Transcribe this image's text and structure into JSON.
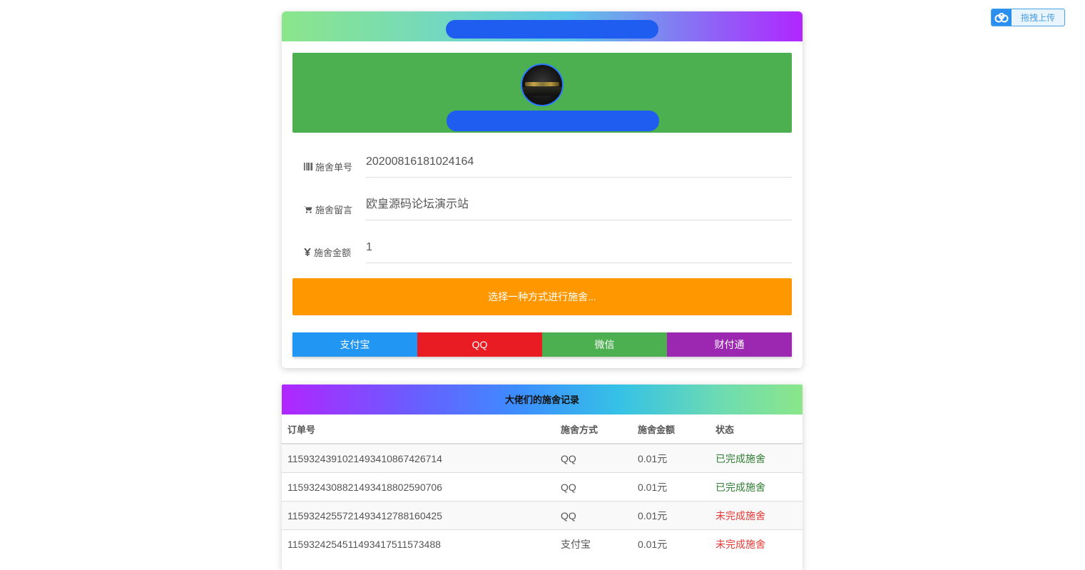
{
  "upload": {
    "label": "拖拽上传",
    "icon": "cloud-icon"
  },
  "form": {
    "order_label": "施舍单号",
    "order_value": "20200816181024164",
    "message_label": "施舍留言",
    "message_value": "欧皇源码论坛演示站",
    "amount_label": "施舍金额",
    "amount_value": "1",
    "choose_text": "选择一种方式进行施舍..."
  },
  "pay_methods": [
    {
      "label": "支付宝",
      "color": "#2196f3"
    },
    {
      "label": "QQ",
      "color": "#e91c24"
    },
    {
      "label": "微信",
      "color": "#4caf50"
    },
    {
      "label": "财付通",
      "color": "#9c27b0"
    }
  ],
  "records": {
    "title": "大佬们的施舍记录",
    "headers": [
      "订单号",
      "施舍方式",
      "施舍金额",
      "状态"
    ],
    "rows": [
      [
        "11593243910214934108674267​14",
        "QQ",
        "0.01元",
        "已完成施舍"
      ],
      [
        "11593243088214934188025907​06",
        "QQ",
        "0.01元",
        "已完成施舍"
      ],
      [
        "11593242557214934127881604​25",
        "QQ",
        "0.01元",
        "未完成施舍"
      ],
      [
        "11593242545114934175115734​88",
        "支付宝",
        "0.01元",
        "未完成施舍"
      ]
    ]
  },
  "colors": {
    "status_done": "#2e7d32",
    "status_pending": "#e53935",
    "choose_bg": "#ff9800",
    "banner_bg": "#4caf50"
  }
}
